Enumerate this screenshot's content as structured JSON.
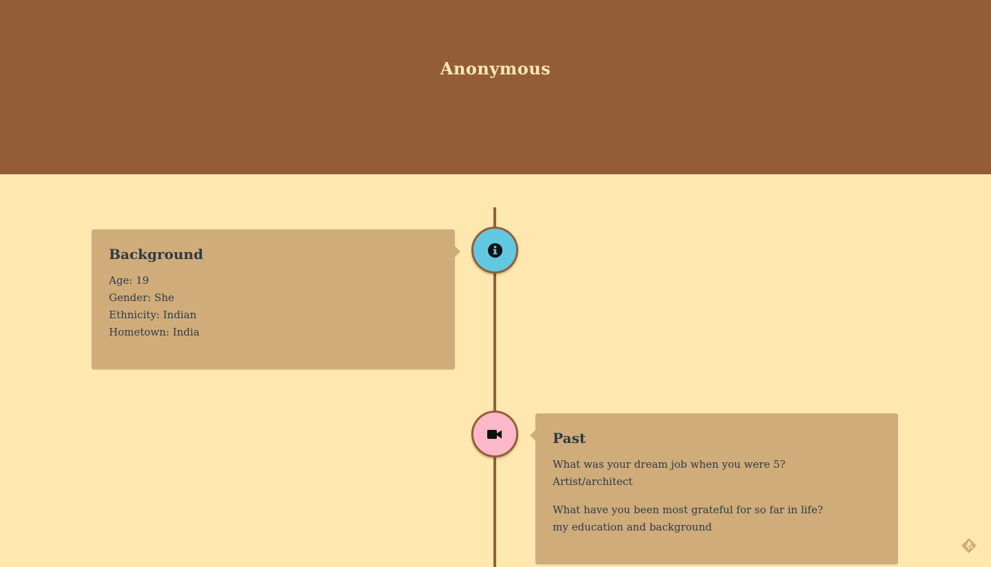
{
  "header": {
    "title": "Anonymous"
  },
  "timeline": {
    "background": {
      "title": "Background",
      "lines": [
        "Age: 19",
        "Gender: She",
        "Ethnicity: Indian",
        "Hometown: India"
      ],
      "icon": "info-circle-icon"
    },
    "past": {
      "title": "Past",
      "qa": [
        {
          "question": "What was your dream job when you were 5?",
          "answer": "Artist/architect"
        },
        {
          "question": "What have you been most grateful for so far in life?",
          "answer": "my education and background"
        }
      ],
      "icon": "video-camera-icon"
    }
  },
  "colors": {
    "header_bg": "#935E37",
    "page_bg": "#FFE8B0",
    "card_bg": "#CFAC7A",
    "info_node": "#62C8E2",
    "video_node": "#FCB8C8",
    "text": "#2E3A48"
  },
  "corner": {
    "icon": "feedly-icon"
  }
}
